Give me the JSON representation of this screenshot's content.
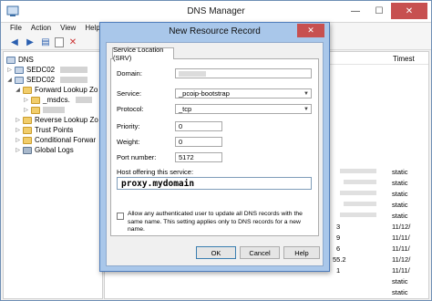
{
  "window": {
    "title": "DNS Manager",
    "min": "—",
    "max": "☐",
    "close": "✕"
  },
  "menu": [
    "File",
    "Action",
    "View",
    "Help"
  ],
  "tree": {
    "root": "DNS",
    "server1": "SEDC02",
    "server2": "SEDC02",
    "forward": "Forward Lookup Zo",
    "msdcs": "_msdcs.",
    "reverse": "Reverse Lookup Zo",
    "trust": "Trust Points",
    "conditional": "Conditional Forwar",
    "logs": "Global Logs"
  },
  "list": {
    "timestamp_header": "Timest",
    "rows": [
      {
        "y": "",
        "ts": "static"
      },
      {
        "y": "",
        "ts": "static"
      },
      {
        "y": "",
        "ts": "static"
      },
      {
        "y": "",
        "ts": "static"
      },
      {
        "y": "",
        "ts": "static"
      },
      {
        "y": "3",
        "ts": "11/12/"
      },
      {
        "y": "9",
        "ts": "11/11/"
      },
      {
        "y": "6",
        "ts": "11/11/"
      },
      {
        "y": "55.2",
        "ts": "11/12/"
      },
      {
        "y": "1",
        "ts": "11/11/"
      },
      {
        "y": "",
        "ts": "static"
      },
      {
        "y": "",
        "ts": "static"
      },
      {
        "y": "",
        "ts": "static"
      }
    ]
  },
  "dialog": {
    "title": "New Resource Record",
    "close": "✕",
    "tab": "Service Location (SRV)",
    "labels": {
      "domain": "Domain:",
      "service": "Service:",
      "protocol": "Protocol:",
      "priority": "Priority:",
      "weight": "Weight:",
      "port": "Port number:",
      "host": "Host offering this service:"
    },
    "values": {
      "service": "_pcoip-bootstrap",
      "protocol": "_tcp",
      "priority": "0",
      "weight": "0",
      "port": "5172",
      "host": "proxy.mydomain"
    },
    "checkbox_text": "Allow any authenticated user to update all DNS records with the same name. This setting applies only to DNS records for a new name.",
    "buttons": {
      "ok": "OK",
      "cancel": "Cancel",
      "help": "Help"
    }
  }
}
